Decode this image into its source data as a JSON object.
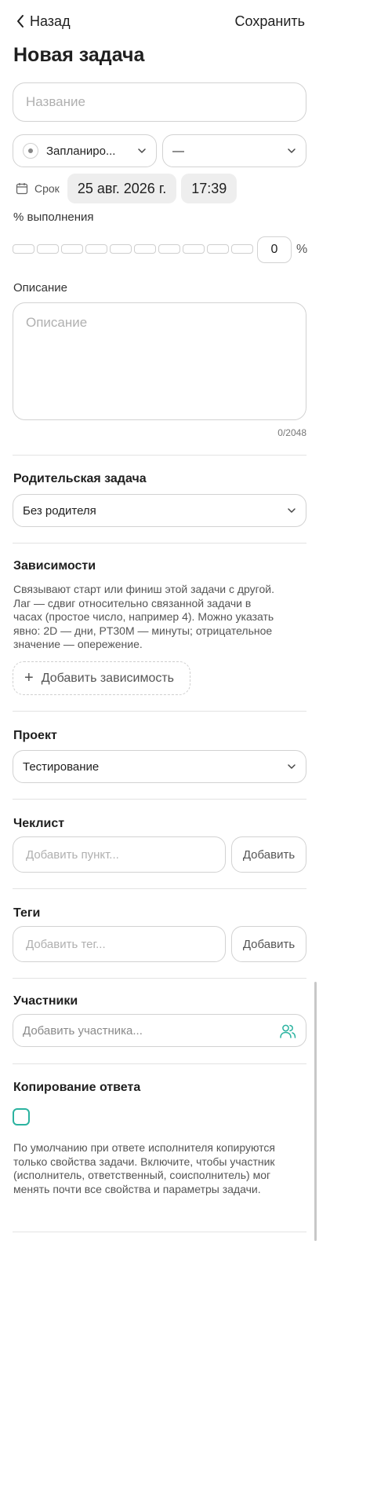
{
  "header": {
    "back_label": "Назад",
    "save_label": "Сохранить",
    "title": "Новая задача"
  },
  "name_field": {
    "placeholder": "Название"
  },
  "status_select": {
    "value": "Запланиро..."
  },
  "priority_select": {
    "value": "—"
  },
  "deadline": {
    "label": "Срок",
    "date": "25 авг. 2026 г.",
    "time": "17:39"
  },
  "progress": {
    "label": "% выполнения",
    "segments": 10,
    "value": "0",
    "unit": "%"
  },
  "description": {
    "label": "Описание",
    "placeholder": "Описание",
    "counter": "0/2048"
  },
  "parent": {
    "title": "Родительская задача",
    "value": "Без родителя"
  },
  "dependencies": {
    "title": "Зависимости",
    "lines": [
      "Связывают старт или финиш этой задачи с другой.",
      "Лаг — сдвиг относительно связанной задачи в",
      "часах (простое число, например 4). Можно указать",
      "явно: 2D — дни, PT30M — минуты; отрицательное",
      "значение — опережение."
    ],
    "add_label": "Добавить зависимость"
  },
  "project": {
    "title": "Проект",
    "value": "Тестирование"
  },
  "checklist": {
    "title": "Чеклист",
    "placeholder": "Добавить пункт...",
    "add_label": "Добавить"
  },
  "tags": {
    "title": "Теги",
    "placeholder": "Добавить тег...",
    "add_label": "Добавить"
  },
  "members": {
    "title": "Участники",
    "placeholder": "Добавить участника..."
  },
  "copy_reply": {
    "title": "Копирование ответа",
    "lines": [
      "По умолчанию при ответе исполнителя копируются",
      "только свойства задачи. Включите, чтобы участник",
      "(исполнитель, ответственный, соисполнитель) мог",
      "менять почти все свойства и параметры задачи."
    ]
  },
  "colors": {
    "accent": "#2bb3a0",
    "border": "#d2d2d2",
    "pill_bg": "#eeeeee"
  }
}
